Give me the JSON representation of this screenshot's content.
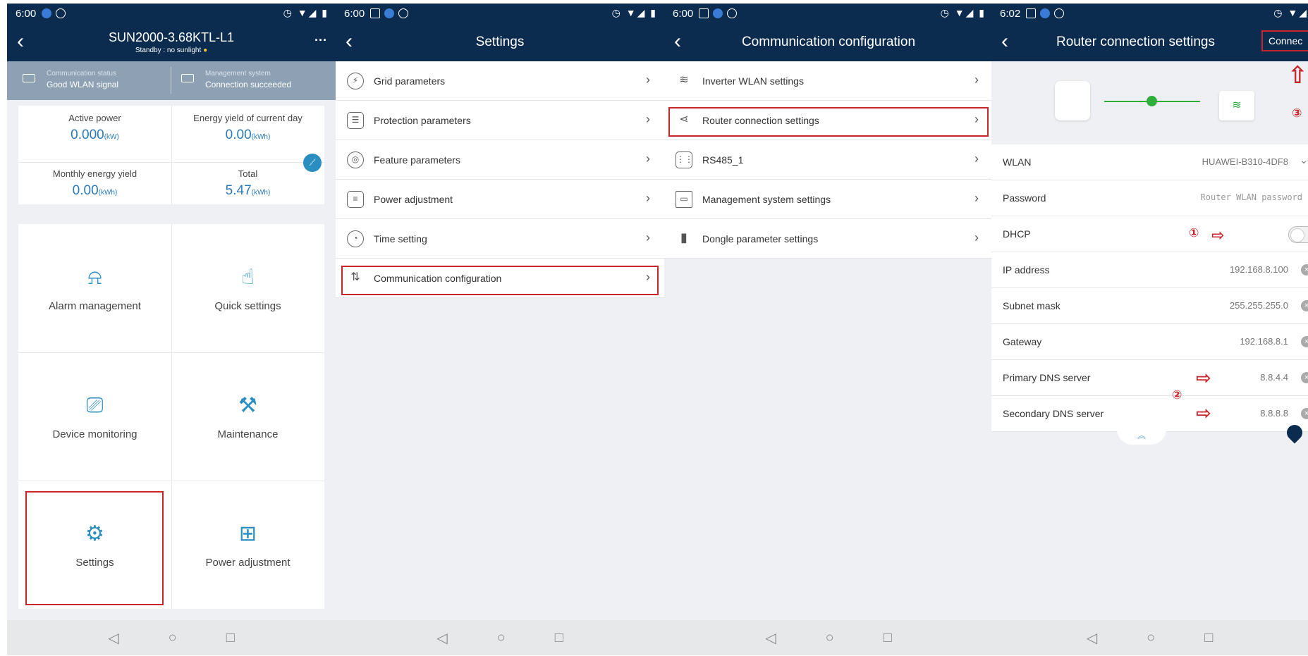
{
  "panel1": {
    "status_bar": {
      "time": "6:00"
    },
    "header": {
      "title": "SUN2000-3.68KTL-L1",
      "subtitle": "Standby : no sunlight"
    },
    "status": {
      "comm_label": "Communication status",
      "comm_value": "Good WLAN signal",
      "mgmt_label": "Management system",
      "mgmt_value": "Connection succeeded"
    },
    "stats": [
      {
        "label": "Active power",
        "value": "0.000",
        "unit": "(kW)"
      },
      {
        "label": "Energy yield of current day",
        "value": "0.00",
        "unit": "(kWh)"
      },
      {
        "label": "Monthly energy yield",
        "value": "0.00",
        "unit": "(kWh)"
      },
      {
        "label": "Total",
        "value": "5.47",
        "unit": "(kWh)"
      }
    ],
    "menu": [
      "Alarm management",
      "Quick settings",
      "Device monitoring",
      "Maintenance",
      "Settings",
      "Power adjustment"
    ],
    "menu_icons": [
      "bell-icon",
      "touch-icon",
      "monitor-icon",
      "wrench-icon",
      "gear-icon",
      "sliders-icon"
    ]
  },
  "panel2": {
    "status_bar": {
      "time": "6:00"
    },
    "header": {
      "title": "Settings"
    },
    "items": [
      "Grid parameters",
      "Protection parameters",
      "Feature parameters",
      "Power adjustment",
      "Time setting",
      "Communication configuration"
    ]
  },
  "panel3": {
    "status_bar": {
      "time": "6:00"
    },
    "header": {
      "title": "Communication configuration"
    },
    "items": [
      "Inverter WLAN settings",
      "Router connection settings",
      "RS485_1",
      "Management system settings",
      "Dongle parameter settings"
    ]
  },
  "panel4": {
    "status_bar": {
      "time": "6:02"
    },
    "header": {
      "title": "Router connection settings",
      "action": "Connec"
    },
    "fields": [
      {
        "label": "WLAN",
        "value": "HUAWEI-B310-4DF8"
      },
      {
        "label": "Password",
        "value": "Router WLAN password"
      },
      {
        "label": "DHCP",
        "value": ""
      },
      {
        "label": "IP address",
        "value": "192.168.8.100"
      },
      {
        "label": "Subnet mask",
        "value": "255.255.255.0"
      },
      {
        "label": "Gateway",
        "value": "192.168.8.1"
      },
      {
        "label": "Primary DNS server",
        "value": "8.8.4.4"
      },
      {
        "label": "Secondary DNS server",
        "value": "8.8.8.8"
      }
    ],
    "annotations": [
      "①",
      "②",
      "③"
    ]
  },
  "colors": {
    "header": "#0b2b4f",
    "accent": "#2a7ab8",
    "highlight": "#c8252c",
    "green": "#2fae3c"
  }
}
